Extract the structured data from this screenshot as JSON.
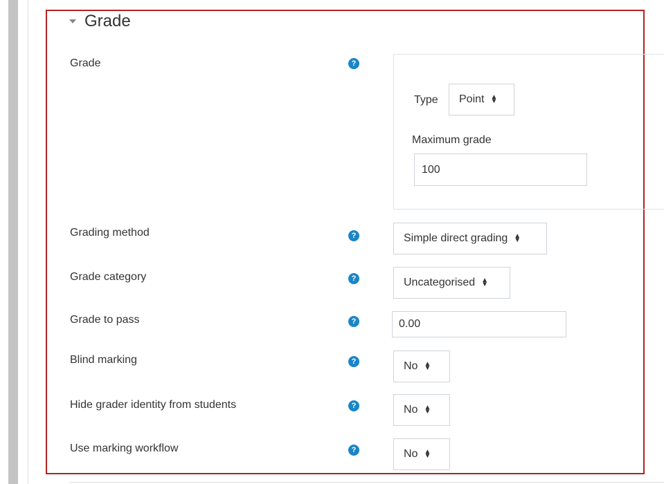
{
  "section": {
    "title": "Grade"
  },
  "grade_field": {
    "label": "Grade",
    "type_label": "Type",
    "type_value": "Point",
    "max_grade_label": "Maximum grade",
    "max_grade_value": "100"
  },
  "fields": {
    "grading_method": {
      "label": "Grading method",
      "value": "Simple direct grading"
    },
    "grade_category": {
      "label": "Grade category",
      "value": "Uncategorised"
    },
    "grade_to_pass": {
      "label": "Grade to pass",
      "value": "0.00"
    },
    "blind_marking": {
      "label": "Blind marking",
      "value": "No"
    },
    "hide_grader": {
      "label": "Hide grader identity from students",
      "value": "No"
    },
    "marking_workflow": {
      "label": "Use marking workflow",
      "value": "No"
    }
  },
  "icons": {
    "help": "question-circle-icon",
    "collapse": "caret-down-icon",
    "select_arrows": "sort-arrows-icon"
  },
  "colors": {
    "highlight_border": "#b22222",
    "help_icon": "#1a85c8"
  }
}
